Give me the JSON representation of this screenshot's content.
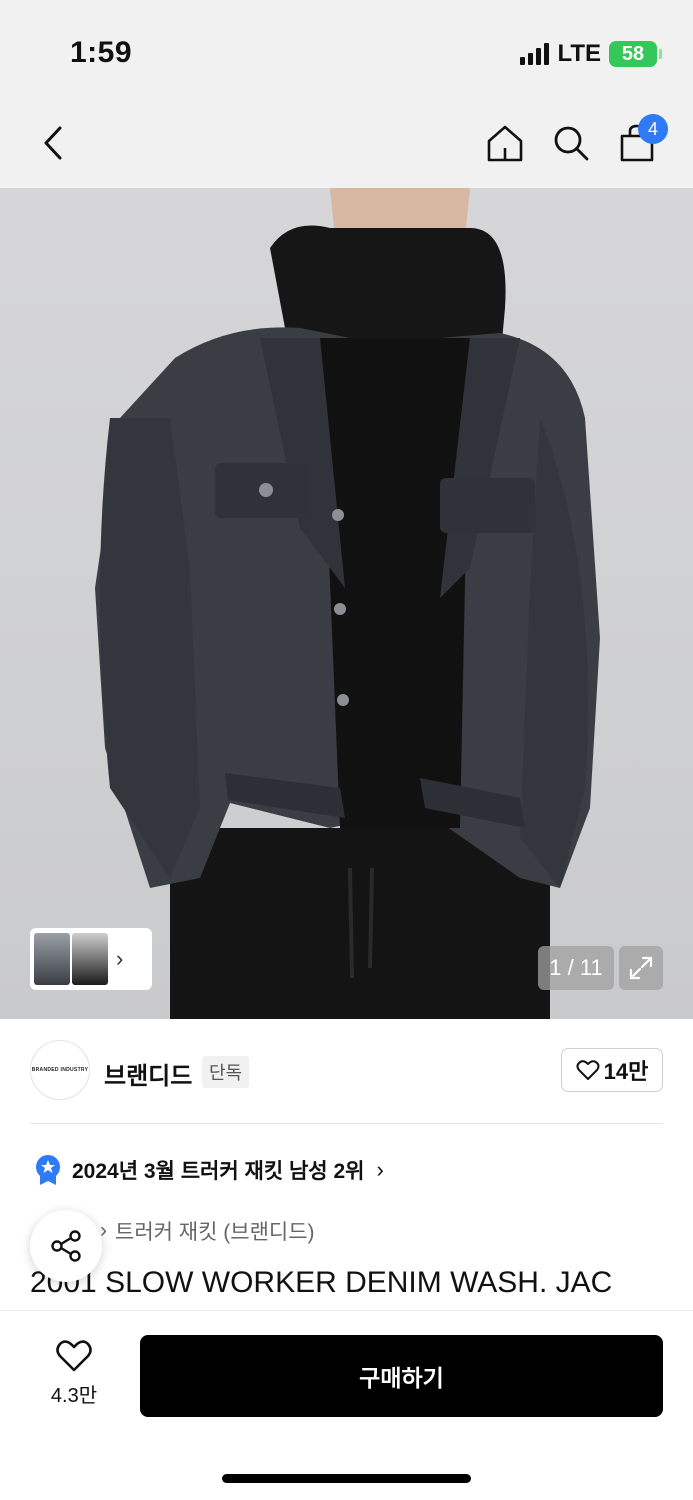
{
  "status_bar": {
    "time": "1:59",
    "network": "LTE",
    "battery": "58"
  },
  "header": {
    "cart_count": "4"
  },
  "gallery": {
    "page_indicator": "1 / 11"
  },
  "brand": {
    "logo_text": "BRANDED INDUSTRY",
    "name": "브랜디드",
    "exclusive_label": "단독",
    "likes": "14만"
  },
  "ranking": {
    "text": "2024년 3월 트러커 재킷 남성 2위"
  },
  "category": {
    "text": "트러커 재킷 (브랜디드)"
  },
  "product": {
    "title": "2001 SLOW WORKER DENIM WASH. JAC"
  },
  "bottom_bar": {
    "wish_count": "4.3만",
    "buy_label": "구매하기"
  },
  "colors": {
    "accent": "#2f7bf6",
    "battery": "#34c759",
    "primary_button": "#000000"
  }
}
